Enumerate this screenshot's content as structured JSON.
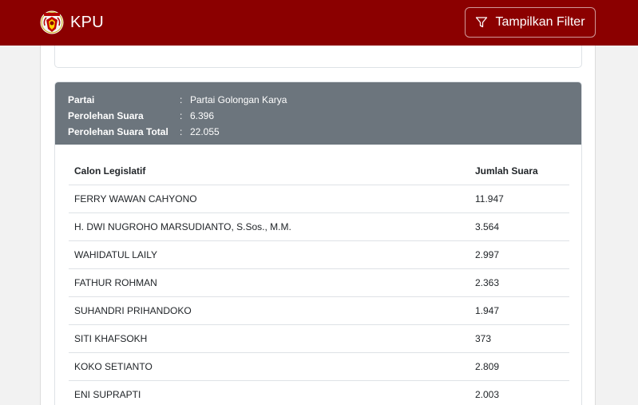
{
  "navbar": {
    "brand": "KPU",
    "filter_button": "Tampilkan Filter",
    "bg_color": "#8b0000"
  },
  "card": {
    "header_color": "#6c757d",
    "info": [
      {
        "label": "Partai",
        "value": "Partai Golongan Karya"
      },
      {
        "label": "Perolehan Suara",
        "value": "6.396"
      },
      {
        "label": "Perolehan Suara Total",
        "value": "22.055"
      }
    ],
    "table": {
      "headers": [
        "Calon Legislatif",
        "Jumlah Suara"
      ],
      "rows": [
        {
          "name": "FERRY WAWAN CAHYONO",
          "votes": "11.947"
        },
        {
          "name": "H. DWI NUGROHO MARSUDIANTO, S.Sos., M.M.",
          "votes": "3.564"
        },
        {
          "name": "WAHIDATUL LAILY",
          "votes": "2.997"
        },
        {
          "name": "FATHUR ROHMAN",
          "votes": "2.363"
        },
        {
          "name": "SUHANDRI PRIHANDOKO",
          "votes": "1.947"
        },
        {
          "name": "SITI KHAFSOKH",
          "votes": "373"
        },
        {
          "name": "KOKO SETIANTO",
          "votes": "2.809"
        },
        {
          "name": "ENI SUPRAPTI",
          "votes": "2.003"
        }
      ]
    }
  }
}
